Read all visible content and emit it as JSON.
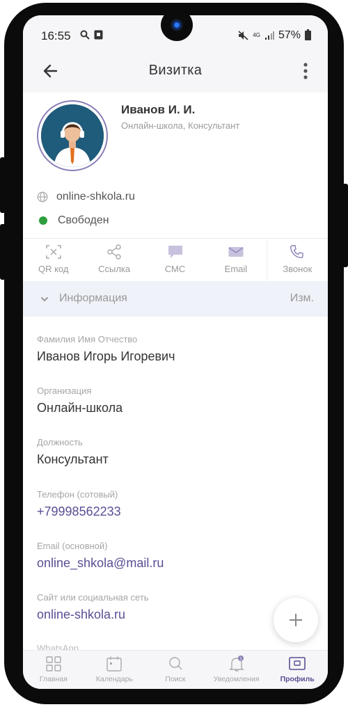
{
  "status_bar": {
    "time": "16:55",
    "network": "4G",
    "battery": "57%"
  },
  "header": {
    "title": "Визитка"
  },
  "profile": {
    "name": "Иванов И. И.",
    "subtitle": "Онлайн-школа, Консультант",
    "website": "online-shkola.ru",
    "status": "Свободен",
    "status_color": "#2e9e3f"
  },
  "actions": [
    {
      "label": "QR код",
      "icon": "qr-icon"
    },
    {
      "label": "Ссылка",
      "icon": "share-icon"
    },
    {
      "label": "СМС",
      "icon": "sms-icon"
    },
    {
      "label": "Email",
      "icon": "mail-icon"
    },
    {
      "label": "Звонок",
      "icon": "phone-icon"
    }
  ],
  "info": {
    "title": "Информация",
    "edit_label": "Изм."
  },
  "fields": [
    {
      "label": "Фамилия Имя Отчество",
      "value": "Иванов Игорь Игоревич"
    },
    {
      "label": "Организация",
      "value": "Онлайн-школа"
    },
    {
      "label": "Должность",
      "value": "Консультант"
    },
    {
      "label": "Телефон  (сотовый)",
      "value": "+79998562233"
    },
    {
      "label": "Email (основной)",
      "value": "online_shkola@mail.ru"
    },
    {
      "label": "Сайт или социальная сеть",
      "value": "online-shkola.ru"
    },
    {
      "label": "WhatsApp"
    }
  ],
  "bottom_nav": [
    {
      "label": "Главная",
      "icon": "home-grid-icon"
    },
    {
      "label": "Календарь",
      "icon": "calendar-icon"
    },
    {
      "label": "Поиск",
      "icon": "search-icon"
    },
    {
      "label": "Уведомления",
      "icon": "bell-icon",
      "badge": "1"
    },
    {
      "label": "Профиль",
      "icon": "profile-icon",
      "active": true
    }
  ],
  "colors": {
    "accent": "#5a4d93",
    "muted": "#a5a5a5",
    "info_bar": "#eff2f8"
  }
}
